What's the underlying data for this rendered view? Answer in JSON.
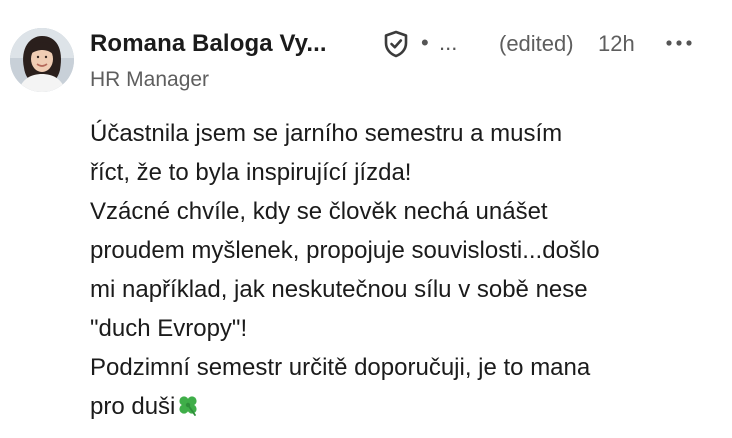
{
  "comment": {
    "author": {
      "name": "Romana Baloga Vy...",
      "headline": "HR Manager",
      "badge_icon": "verified-shield-icon",
      "separator": "•",
      "degree": "..."
    },
    "meta": {
      "edited": "(edited)",
      "time": "12h",
      "more_icon": "more-horizontal-icon"
    },
    "body_lines": [
      "Účastnila jsem se jarního semestru a musím",
      "říct, že to byla inspirující jízda!",
      "Vzácné chvíle, kdy se člověk nechá unášet",
      "proudem myšlenek, propojuje souvislosti...došlo",
      "mi například, jak neskutečnou sílu v sobě nese",
      "\"duch Evropy\"!",
      "Podzimní semestr určitě doporučuji, je to mana",
      "pro duši"
    ],
    "trailing_emoji": "four-leaf-clover-icon",
    "colors": {
      "text_primary": "#1b1b1b",
      "text_secondary": "#5e5e5e",
      "clover_green": "#3fae49"
    }
  }
}
